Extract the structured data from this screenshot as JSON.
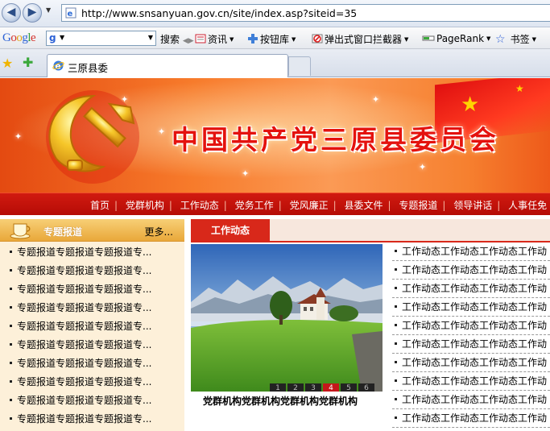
{
  "browser": {
    "url": "http://www.snsanyuan.gov.cn/site/index.asp?siteid=35",
    "tab_title": "三原县委",
    "toolbar": {
      "search": "搜索",
      "news": "资讯",
      "button_gallery": "按钮库",
      "popup_blocker": "弹出式窗口拦截器",
      "pagerank": "PageRank",
      "bookmarks": "书签"
    }
  },
  "banner": {
    "title": "中国共产党三原县委员会"
  },
  "topnav": {
    "items": [
      "首页",
      "党群机构",
      "工作动态",
      "党务工作",
      "党风廉正",
      "县委文件",
      "专题报道",
      "领导讲话",
      "人事任免"
    ]
  },
  "left_panel": {
    "title": "专题报道",
    "more": "更多...",
    "items": [
      "专题报道专题报道专题报道专...",
      "专题报道专题报道专题报道专...",
      "专题报道专题报道专题报道专...",
      "专题报道专题报道专题报道专...",
      "专题报道专题报道专题报道专...",
      "专题报道专题报道专题报道专...",
      "专题报道专题报道专题报道专...",
      "专题报道专题报道专题报道专...",
      "专题报道专题报道专题报道专...",
      "专题报道专题报道专题报道专..."
    ]
  },
  "center": {
    "tab_active": "工作动态",
    "photo_caption": "党群机构党群机构党群机构党群机构",
    "pager": [
      "1",
      "2",
      "3",
      "4",
      "5",
      "6"
    ],
    "pager_active_index": 3
  },
  "right_list": {
    "items": [
      "工作动态工作动态工作动态工作动",
      "工作动态工作动态工作动态工作动",
      "工作动态工作动态工作动态工作动",
      "工作动态工作动态工作动态工作动",
      "工作动态工作动态工作动态工作动",
      "工作动态工作动态工作动态工作动",
      "工作动态工作动态工作动态工作动",
      "工作动态工作动态工作动态工作动",
      "工作动态工作动态工作动态工作动",
      "工作动态工作动态工作动态工作动"
    ]
  },
  "colors": {
    "nav_red": "#c4160c",
    "panel_gold": "#e9a83a",
    "tab_red": "#d8281a",
    "panel_cream": "#fdf0d9"
  }
}
